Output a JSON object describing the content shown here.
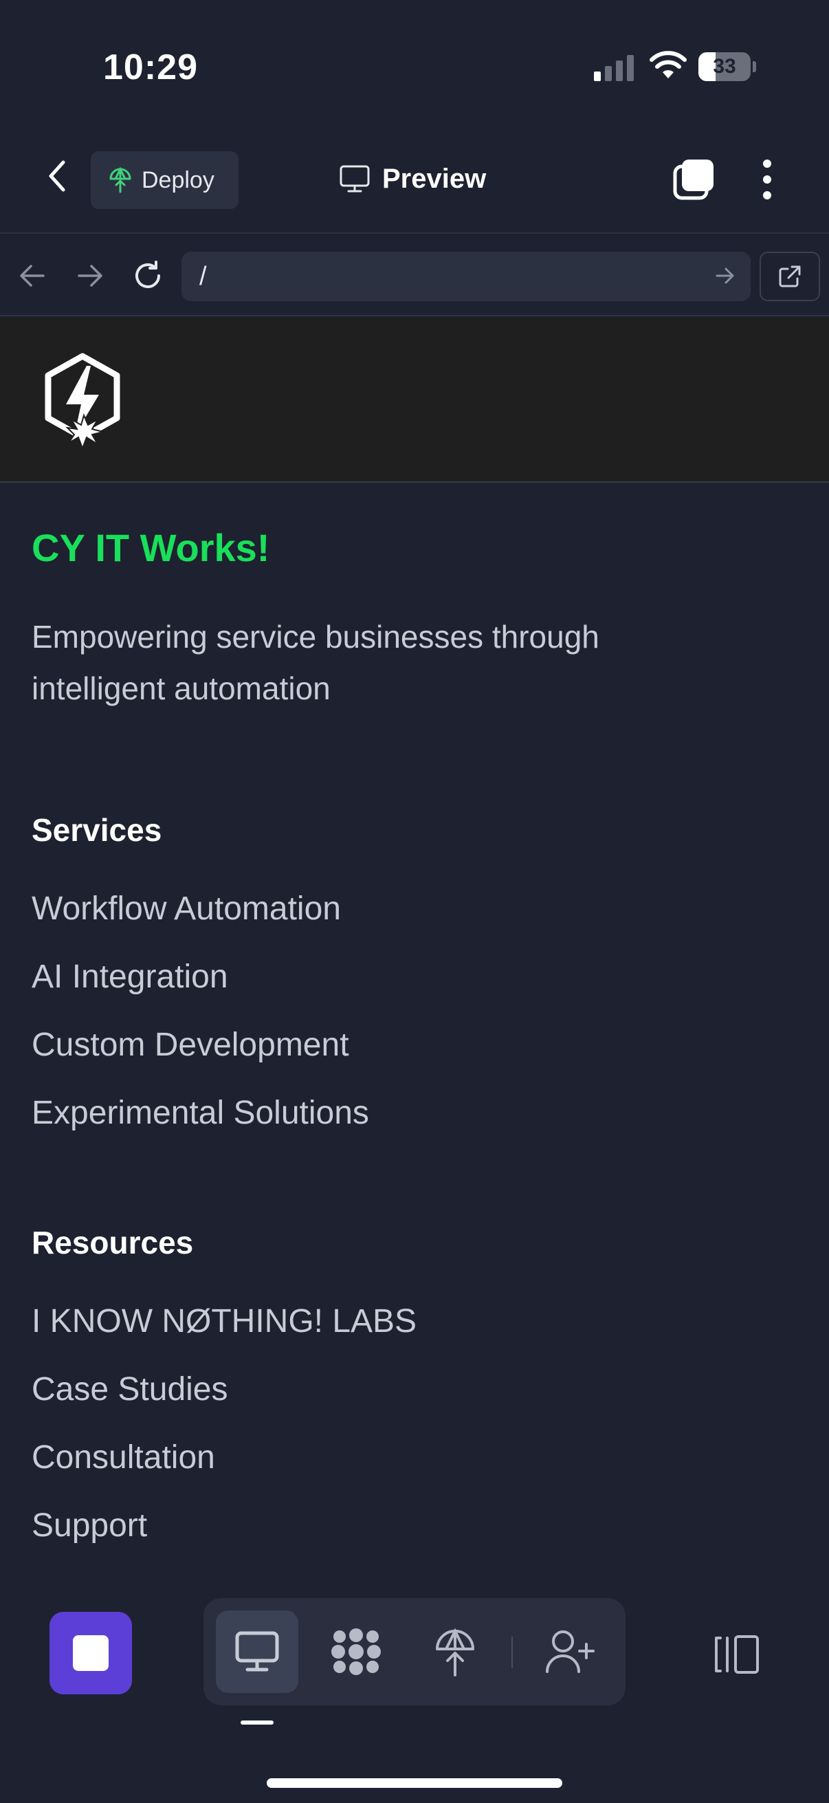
{
  "status_bar": {
    "time": "10:29",
    "battery_percent": "33",
    "battery_level": 0.33
  },
  "header": {
    "back_icon": "chevron-left-icon",
    "deploy_label": "Deploy",
    "deploy_icon": "deploy-icon",
    "preview_label": "Preview",
    "preview_icon": "monitor-icon",
    "tabs_icon": "tabs-icon",
    "more_icon": "more-vertical-icon"
  },
  "browser": {
    "url": "/",
    "back_icon": "arrow-left-icon",
    "forward_icon": "arrow-right-icon",
    "reload_icon": "reload-icon",
    "go_icon": "arrow-right-icon",
    "open_external_icon": "external-link-icon"
  },
  "site": {
    "brand": "CY IT Works!",
    "tagline": "Empowering service businesses through intelligent automation",
    "services": {
      "title": "Services",
      "items": [
        "Workflow Automation",
        "AI Integration",
        "Custom Development",
        "Experimental Solutions"
      ]
    },
    "resources": {
      "title": "Resources",
      "items": [
        "I KNOW NØTHING! LABS",
        "Case Studies",
        "Consultation",
        "Support"
      ]
    }
  },
  "bottom_toolbar": {
    "stop_icon": "stop-icon",
    "tools": [
      "monitor-icon",
      "agents-icon",
      "deploy-icon",
      "add-user-icon"
    ],
    "split_icon": "split-view-icon"
  },
  "colors": {
    "background": "#1e2130",
    "brand_green": "#19e05a",
    "stop_purple": "#5c3fd6",
    "site_header": "#1f1f1f"
  }
}
